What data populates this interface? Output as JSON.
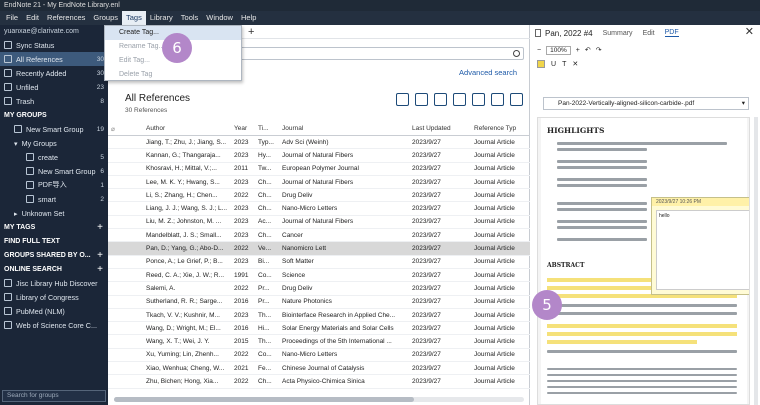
{
  "window": {
    "title": "EndNote 21 - My EndNote Library.enl"
  },
  "menu": [
    "File",
    "Edit",
    "References",
    "Groups",
    "Tags",
    "Library",
    "Tools",
    "Window",
    "Help"
  ],
  "tags_menu": {
    "items": [
      "Create Tag...",
      "Rename Tag...",
      "Edit Tag...",
      "Delete Tag"
    ]
  },
  "badges": {
    "six": "6",
    "five": "5"
  },
  "sidebar": {
    "email": "yuanxae@clarivate.com",
    "sync": "Sync Status",
    "all_refs": {
      "label": "All References",
      "count": "30"
    },
    "recent": {
      "label": "Recently Added",
      "count": "30"
    },
    "unfiled": {
      "label": "Unfiled",
      "count": "23"
    },
    "trash": {
      "label": "Trash",
      "count": "8"
    },
    "my_groups": "MY GROUPS",
    "new_smart_group": {
      "label": "New Smart Group",
      "count": "19"
    },
    "my_groups_sub": "My Groups",
    "groups": [
      {
        "label": "create",
        "count": "5"
      },
      {
        "label": "New Smart Group",
        "count": "6"
      },
      {
        "label": "PDF导入",
        "count": "1"
      },
      {
        "label": "smart",
        "count": "2"
      }
    ],
    "unknown_set": "Unknown Set",
    "my_tags": "MY TAGS",
    "find_full_text": "FIND FULL TEXT",
    "groups_shared": "GROUPS SHARED BY O...",
    "online_search": "ONLINE SEARCH",
    "online": [
      "Jisc Library Hub Discover",
      "Library of Congress",
      "PubMed (NLM)",
      "Web of Science Core C..."
    ],
    "search_placeholder": "Search for groups"
  },
  "center": {
    "advanced_search": "Advanced search",
    "title": "All References",
    "count": "30 References",
    "columns": [
      "Author",
      "Year",
      "Ti...",
      "Journal",
      "Last Updated",
      "Reference Typ"
    ],
    "rows": [
      {
        "author": "Jiang, T.; Zhu, J.; Jiang, S...",
        "year": "2023",
        "title": "Typ...",
        "journal": "Adv Sci (Weinh)",
        "updated": "2023/9/27",
        "type": "Journal Article"
      },
      {
        "author": "Kannan, G.; Thangaraja...",
        "year": "2023",
        "title": "Hy...",
        "journal": "Journal of Natural Fibers",
        "updated": "2023/9/27",
        "type": "Journal Article"
      },
      {
        "author": "Khosravi, H.; Mittal, V.;...",
        "year": "2011",
        "title": "Tw...",
        "journal": "European Polymer Journal",
        "updated": "2023/9/27",
        "type": "Journal Article"
      },
      {
        "author": "Lee, M. K. Y.; Hwang, S...",
        "year": "2023",
        "title": "Ch...",
        "journal": "Journal of Natural Fibers",
        "updated": "2023/9/27",
        "type": "Journal Article"
      },
      {
        "author": "Li, S.; Zhang, H.; Chen...",
        "year": "2022",
        "title": "Ch...",
        "journal": "Drug Deliv",
        "updated": "2023/9/27",
        "type": "Journal Article"
      },
      {
        "author": "Liang, J. J.; Wang, S. J.; L...",
        "year": "2023",
        "title": "Ch...",
        "journal": "Nano-Micro Letters",
        "updated": "2023/9/27",
        "type": "Journal Article"
      },
      {
        "author": "Liu, M. Z.; Johnston, M. ...",
        "year": "2023",
        "title": "Ac...",
        "journal": "Journal of Natural Fibers",
        "updated": "2023/9/27",
        "type": "Journal Article"
      },
      {
        "author": "Mandelblatt, J. S.; Small...",
        "year": "2023",
        "title": "Ch...",
        "journal": "Cancer",
        "updated": "2023/9/27",
        "type": "Journal Article"
      },
      {
        "author": "Pan, D.; Yang, G.; Abo-D...",
        "year": "2022",
        "title": "Ve...",
        "journal": "Nanomicro Lett",
        "updated": "2023/9/27",
        "type": "Journal Article"
      },
      {
        "author": "Ponce, A.; Le Grief, P.; B...",
        "year": "2023",
        "title": "Bi...",
        "journal": "Soft Matter",
        "updated": "2023/9/27",
        "type": "Journal Article"
      },
      {
        "author": "Reed, C. A.; Xie, J. W.; R...",
        "year": "1991",
        "title": "Co...",
        "journal": "Science",
        "updated": "2023/9/27",
        "type": "Journal Article"
      },
      {
        "author": "Salemi, A.",
        "year": "2022",
        "title": "Pr...",
        "journal": "Drug Deliv",
        "updated": "2023/9/27",
        "type": "Journal Article"
      },
      {
        "author": "Sutherland, R. R.; Sarge...",
        "year": "2016",
        "title": "Pr...",
        "journal": "Nature Photonics",
        "updated": "2023/9/27",
        "type": "Journal Article"
      },
      {
        "author": "Tkach, V. V.; Kushnir, M...",
        "year": "2023",
        "title": "Th...",
        "journal": "Biointerface Research in Applied Che...",
        "updated": "2023/9/27",
        "type": "Journal Article"
      },
      {
        "author": "Wang, D.; Wright, M.; El...",
        "year": "2016",
        "title": "Hi...",
        "journal": "Solar Energy Materials and Solar Cells",
        "updated": "2023/9/27",
        "type": "Journal Article"
      },
      {
        "author": "Wang, X. T.; Wei, J. Y.",
        "year": "2015",
        "title": "Th...",
        "journal": "Proceedings of the 5th International ...",
        "updated": "2023/9/27",
        "type": "Journal Article"
      },
      {
        "author": "Xu, Yuming; Lin, Zhenh...",
        "year": "2022",
        "title": "Co...",
        "journal": "Nano-Micro Letters",
        "updated": "2023/9/27",
        "type": "Journal Article"
      },
      {
        "author": "Xiao, Wenhua; Cheng, W...",
        "year": "2021",
        "title": "Fe...",
        "journal": "Chinese Journal of Catalysis",
        "updated": "2023/9/27",
        "type": "Journal Article"
      },
      {
        "author": "Zhu, Bichen; Hong, Xia...",
        "year": "2022",
        "title": "Ch...",
        "journal": "Acta Physico-Chimica Sinica",
        "updated": "2023/9/27",
        "type": "Journal Article"
      }
    ]
  },
  "right_panel": {
    "ref_title": "Pan, 2022 #4",
    "tabs": [
      "Summary",
      "Edit",
      "PDF"
    ],
    "zoom": "100%",
    "file": "Pan-2022-Vertically-aligned-silicon-carbide-.pdf",
    "pdf_heading": "HIGHLIGHTS",
    "abstract_label": "ABSTRACT",
    "note_header": "2023/9/27 10:26 PM",
    "note_text": "hello"
  }
}
